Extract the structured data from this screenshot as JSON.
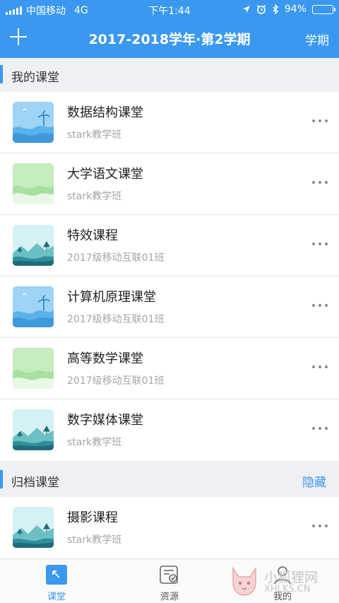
{
  "status_bar": {
    "carrier": "中国移动",
    "network": "4G",
    "time": "下午1:44",
    "battery": "94%",
    "battery_level": 0.94,
    "icons": [
      "signal-icon",
      "location-icon",
      "alarm-icon",
      "bluetooth-icon",
      "battery-icon"
    ]
  },
  "nav": {
    "title": "2017-2018学年·第2学期",
    "right_label": "学期",
    "left_icon": "plus-icon"
  },
  "sections": {
    "my": {
      "title": "我的课堂"
    },
    "archived": {
      "title": "归档课堂",
      "action": "隐藏"
    }
  },
  "my_courses": [
    {
      "name": "数据结构课堂",
      "class": "stark教学班",
      "cover": "blue-wave"
    },
    {
      "name": "大学语文课堂",
      "class": "stark教学班",
      "cover": "green-hills"
    },
    {
      "name": "特效课程",
      "class": "2017级移动互联01班",
      "cover": "teal-landscape"
    },
    {
      "name": "计算机原理课堂",
      "class": "2017级移动互联01班",
      "cover": "blue-wave"
    },
    {
      "name": "高等数学课堂",
      "class": "2017级移动互联01班",
      "cover": "green-hills"
    },
    {
      "name": "数字媒体课堂",
      "class": "stark教学班",
      "cover": "teal-landscape"
    }
  ],
  "archived_courses": [
    {
      "name": "摄影课程",
      "class": "stark教学班",
      "cover": "teal-landscape"
    }
  ],
  "tabs": [
    {
      "label": "课堂",
      "icon": "classroom-icon",
      "active": true
    },
    {
      "label": "资源",
      "icon": "resource-icon",
      "active": false
    },
    {
      "label": "我的",
      "icon": "profile-icon",
      "active": false
    }
  ],
  "watermark": {
    "text": "小狐狸网",
    "sub": "XHLKS.CN"
  },
  "colors": {
    "primary": "#3a98f0",
    "background": "#eef0f3",
    "muted_text": "#a5a5a5"
  }
}
